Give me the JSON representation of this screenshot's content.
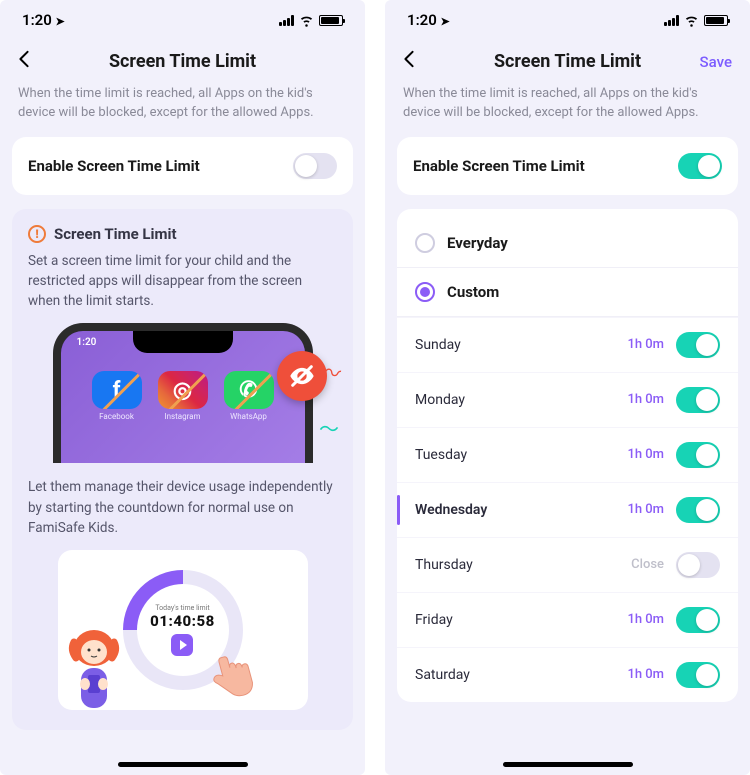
{
  "status": {
    "time": "1:20",
    "loc_icon": "➤"
  },
  "header": {
    "back": "‹",
    "title": "Screen Time Limit",
    "save": "Save"
  },
  "description": "When the time limit is reached, all Apps on the kid's device will be blocked, except for the allowed Apps.",
  "enable": {
    "label": "Enable Screen Time Limit"
  },
  "info": {
    "title": "Screen Time Limit",
    "para1": "Set a screen time limit for your child and the restricted apps will disappear from the screen when the limit starts.",
    "para2": "Let them manage their device usage independently by starting the countdown for normal use on FamiSafe Kids."
  },
  "mock": {
    "time": "1:20",
    "apps": [
      {
        "name": "Facebook",
        "letter": "f",
        "cls": "fb"
      },
      {
        "name": "Instagram",
        "letter": "◎",
        "cls": "ig"
      },
      {
        "name": "WhatsApp",
        "letter": "✆",
        "cls": "wa"
      }
    ],
    "card_label": "Today's time limit",
    "card_time": "01:40:58"
  },
  "schedule": {
    "modes": [
      {
        "key": "everyday",
        "label": "Everyday",
        "selected": false
      },
      {
        "key": "custom",
        "label": "Custom",
        "selected": true
      }
    ],
    "days": [
      {
        "name": "Sunday",
        "duration": "1h 0m",
        "enabled": true,
        "highlight": false
      },
      {
        "name": "Monday",
        "duration": "1h 0m",
        "enabled": true,
        "highlight": false
      },
      {
        "name": "Tuesday",
        "duration": "1h 0m",
        "enabled": true,
        "highlight": false
      },
      {
        "name": "Wednesday",
        "duration": "1h 0m",
        "enabled": true,
        "highlight": true
      },
      {
        "name": "Thursday",
        "duration": "Close",
        "enabled": false,
        "highlight": false
      },
      {
        "name": "Friday",
        "duration": "1h 0m",
        "enabled": true,
        "highlight": false
      },
      {
        "name": "Saturday",
        "duration": "1h 0m",
        "enabled": true,
        "highlight": false
      }
    ]
  }
}
